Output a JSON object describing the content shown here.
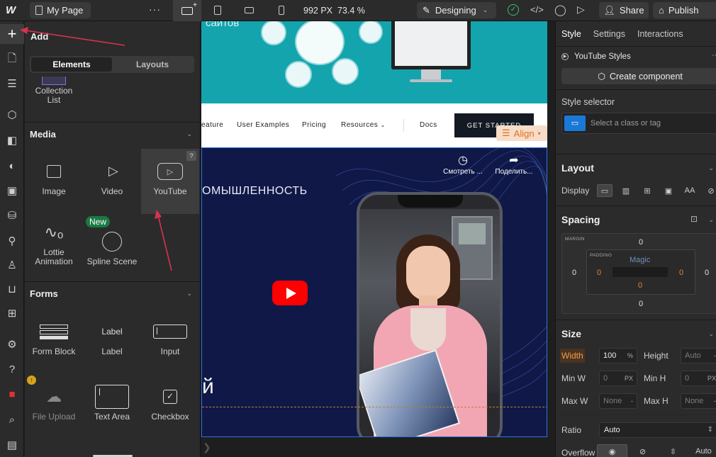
{
  "topbar": {
    "page_name": "My Page",
    "menu_dots": "···",
    "viewport_width": "992 PX",
    "zoom": "73.4 %",
    "mode_label": "Designing",
    "share_label": "Share",
    "publish_label": "Publish"
  },
  "add_panel": {
    "title": "Add",
    "tabs": [
      "Elements",
      "Layouts"
    ],
    "active_tab": "Elements",
    "collection_list_label": "Collection List",
    "sections": {
      "media": {
        "title": "Media",
        "items": [
          "Image",
          "Video",
          "YouTube",
          "Lottie Animation",
          "Spline Scene"
        ],
        "new_badge": "New",
        "help": "?"
      },
      "forms": {
        "title": "Forms",
        "items": [
          "Form Block",
          "Label",
          "Input",
          "File Upload",
          "Text Area",
          "Checkbox"
        ],
        "label_preview": "Label"
      }
    }
  },
  "canvas": {
    "hero_partial_text": "сайтов",
    "nav": {
      "links": [
        "eature",
        "User Examples",
        "Pricing",
        "Resources",
        "Docs"
      ],
      "cta": "GET STARTED"
    },
    "align_label": "Align",
    "video": {
      "title_partial": "ОМЫШЛЕННОСТЬ",
      "big_letter": "й",
      "action_watch": "Смотреть ...",
      "action_share": "Поделить..."
    }
  },
  "right_panel": {
    "tabs": [
      "Style",
      "Settings",
      "Interactions"
    ],
    "active_tab": "Style",
    "element_name": "YouTube Styles",
    "create_component": "Create component",
    "style_selector_label": "Style selector",
    "style_selector_placeholder": "Select a class or tag",
    "layout": {
      "title": "Layout",
      "display_label": "Display"
    },
    "spacing": {
      "title": "Spacing",
      "margin_label": "MARGIN",
      "padding_label": "PADDING",
      "magic_label": "Magic",
      "margin": {
        "top": "0",
        "right": "0",
        "bottom": "0",
        "left": "0"
      },
      "padding": {
        "top": "0",
        "right": "0",
        "bottom": "0",
        "left": "0"
      }
    },
    "size": {
      "title": "Size",
      "width_label": "Width",
      "width_value": "100",
      "width_unit": "%",
      "height_label": "Height",
      "height_value": "Auto",
      "height_unit": "-",
      "min_w_label": "Min W",
      "min_w_value": "0",
      "min_w_unit": "PX",
      "min_h_label": "Min H",
      "min_h_value": "0",
      "min_h_unit": "PX",
      "max_w_label": "Max W",
      "max_w_value": "None",
      "max_w_unit": "-",
      "max_h_label": "Max H",
      "max_h_value": "None",
      "max_h_unit": "-",
      "ratio_label": "Ratio",
      "ratio_value": "Auto",
      "overflow_label": "Overflow",
      "overflow_auto": "Auto"
    }
  },
  "colors": {
    "accent_blue": "#1a78d6",
    "annotation_arrow": "#d6334f",
    "ok_green": "#3ec06a",
    "youtube_red": "#ff0000"
  }
}
